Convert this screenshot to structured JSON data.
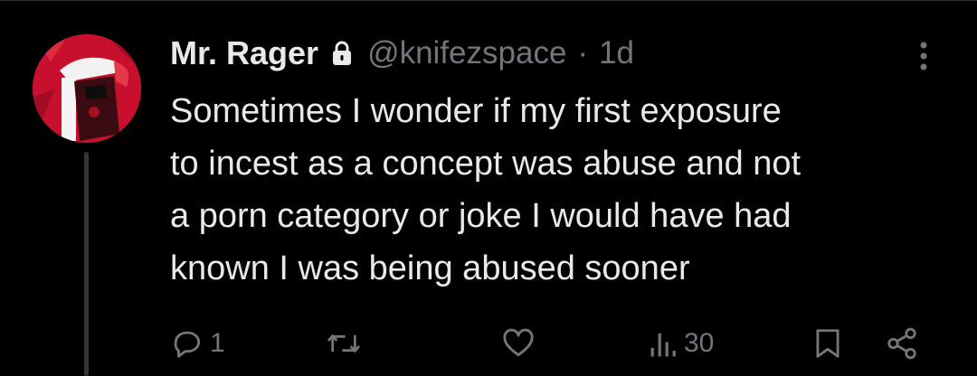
{
  "post": {
    "author_name": "Mr. Rager",
    "handle": "@knifezspace",
    "separator": "·",
    "time": "1d",
    "text_lines": [
      "Sometimes I wonder if my first exposure",
      "to incest as a concept was abuse and not",
      "a porn category or joke I would have had",
      "known I was being abused sooner"
    ]
  },
  "actions": {
    "reply_count": "1",
    "views_count": "30"
  },
  "icons": {
    "lock": "lock-icon",
    "more": "more-vertical-icon",
    "reply": "reply-icon",
    "repost": "repost-icon",
    "like": "like-icon",
    "views": "views-icon",
    "bookmark": "bookmark-icon",
    "share": "share-icon"
  },
  "colors": {
    "background": "#000000",
    "text_primary": "#e7e9ea",
    "text_secondary": "#71767b",
    "avatar_accent": "#c8102e"
  }
}
